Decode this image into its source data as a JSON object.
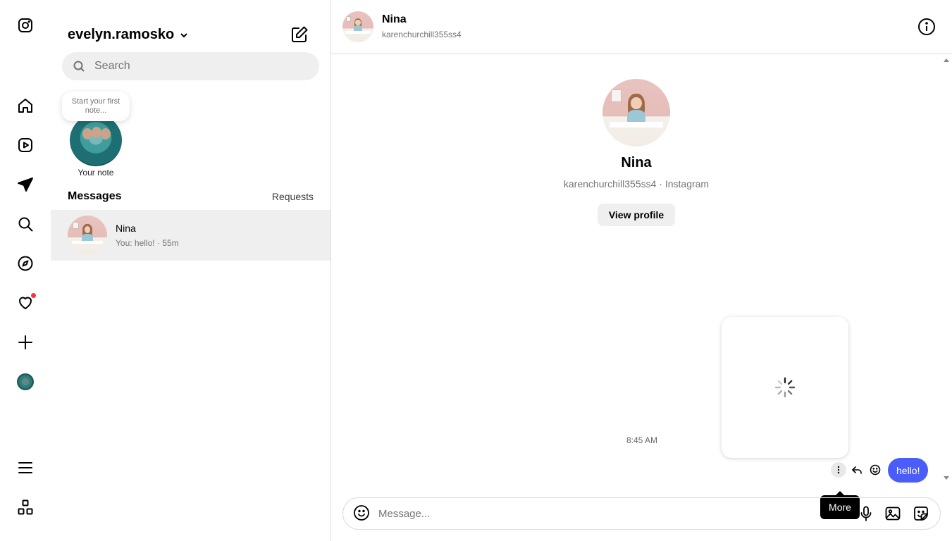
{
  "sidebar": {
    "account_name": "evelyn.ramosko",
    "search_placeholder": "Search",
    "note_prompt": "Start your first note...",
    "note_label": "Your note",
    "messages_title": "Messages",
    "requests_label": "Requests",
    "threads": [
      {
        "name": "Nina",
        "preview": "You: hello! · 55m",
        "selected": true
      }
    ]
  },
  "chat": {
    "name": "Nina",
    "username": "karenchurchill355ss4",
    "profile_meta": "karenchurchill355ss4 · Instagram",
    "view_profile_label": "View profile",
    "timestamp": "8:45 AM",
    "message_text": "hello!",
    "tooltip": "More",
    "composer_placeholder": "Message..."
  },
  "colors": {
    "accent_bubble": "#4a5df9",
    "notification_dot": "#ff3040",
    "selected_row": "#efefef"
  },
  "icons": [
    "instagram-icon",
    "home-icon",
    "reels-icon",
    "messages-icon",
    "search-icon",
    "explore-icon",
    "heart-icon",
    "create-icon",
    "menu-icon",
    "threads-icon"
  ]
}
